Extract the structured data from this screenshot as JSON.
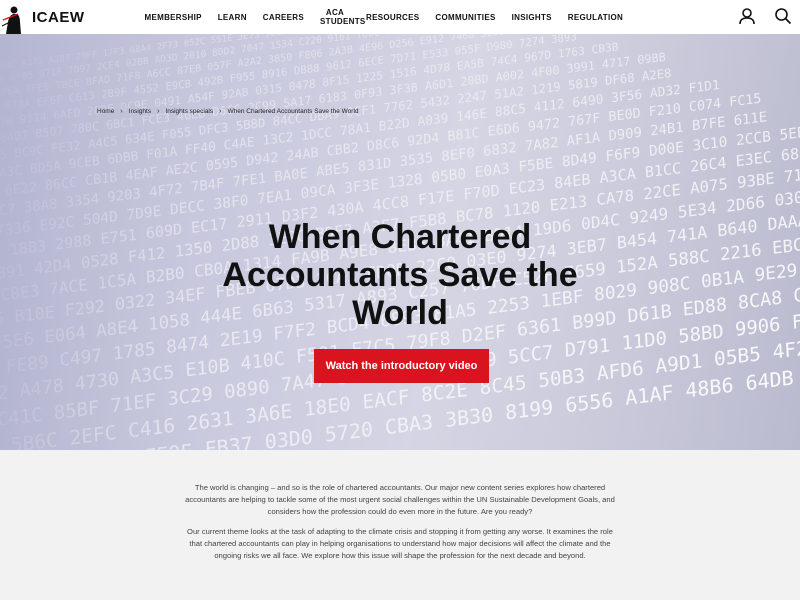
{
  "header": {
    "logo_text": "ICAEW",
    "nav": [
      {
        "label": "MEMBERSHIP"
      },
      {
        "label": "LEARN"
      },
      {
        "label": "CAREERS"
      },
      {
        "label_line1": "ACA",
        "label_line2": "STUDENTS"
      },
      {
        "label": "RESOURCES"
      },
      {
        "label": "COMMUNITIES"
      },
      {
        "label": "INSIGHTS"
      },
      {
        "label": "REGULATION"
      }
    ],
    "icons": [
      "user-icon",
      "search-icon"
    ]
  },
  "breadcrumb": [
    {
      "label": "Home"
    },
    {
      "label": "Insights"
    },
    {
      "label": "Insights specials"
    },
    {
      "label": "When Chartered Accountants Save the World"
    }
  ],
  "hero": {
    "title": "When Chartered Accountants Save the World",
    "cta_label": "Watch the introductory video",
    "cta_color": "#d8141e"
  },
  "intro": {
    "paragraph1": "The world is changing – and so is the role of chartered accountants. Our major new content series explores how chartered accountants are helping to tackle some of the most urgent social challenges within the UN Sustainable Development Goals, and considers how the profession could do even more in the future. Are you ready?",
    "paragraph2": "Our current theme looks at the task of adapting to the climate crisis and stopping it from getting any worse. It examines the role that chartered accountants can play in helping organisations to understand how major decisions will affect the climate and the ongoing risks we all face. We explore how this issue will shape the profession for the next decade and beyond."
  }
}
